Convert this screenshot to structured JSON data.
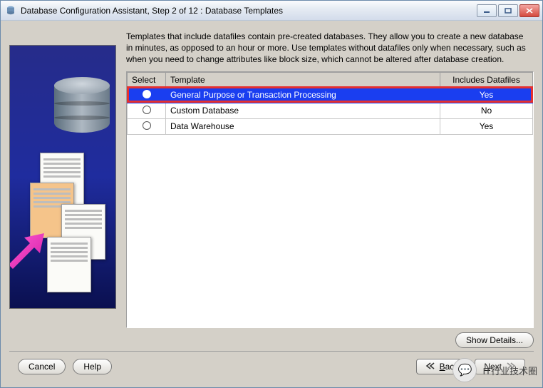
{
  "window": {
    "title": "Database Configuration Assistant, Step 2 of 12 : Database Templates"
  },
  "intro": "Templates that include datafiles contain pre-created databases. They allow you to create a new database in minutes, as opposed to an hour or more. Use templates without datafiles only when necessary, such as when you need to change attributes like block size, which cannot be altered after database creation.",
  "table": {
    "headers": {
      "select": "Select",
      "template": "Template",
      "includes": "Includes Datafiles"
    },
    "rows": [
      {
        "selected": true,
        "template": "General Purpose or Transaction Processing",
        "includes": "Yes"
      },
      {
        "selected": false,
        "template": "Custom Database",
        "includes": "No"
      },
      {
        "selected": false,
        "template": "Data Warehouse",
        "includes": "Yes"
      }
    ]
  },
  "buttons": {
    "show_details": "Show Details...",
    "cancel": "Cancel",
    "help": "Help",
    "back": "Back",
    "next": "Next"
  },
  "watermark": "IT行业技术圈"
}
